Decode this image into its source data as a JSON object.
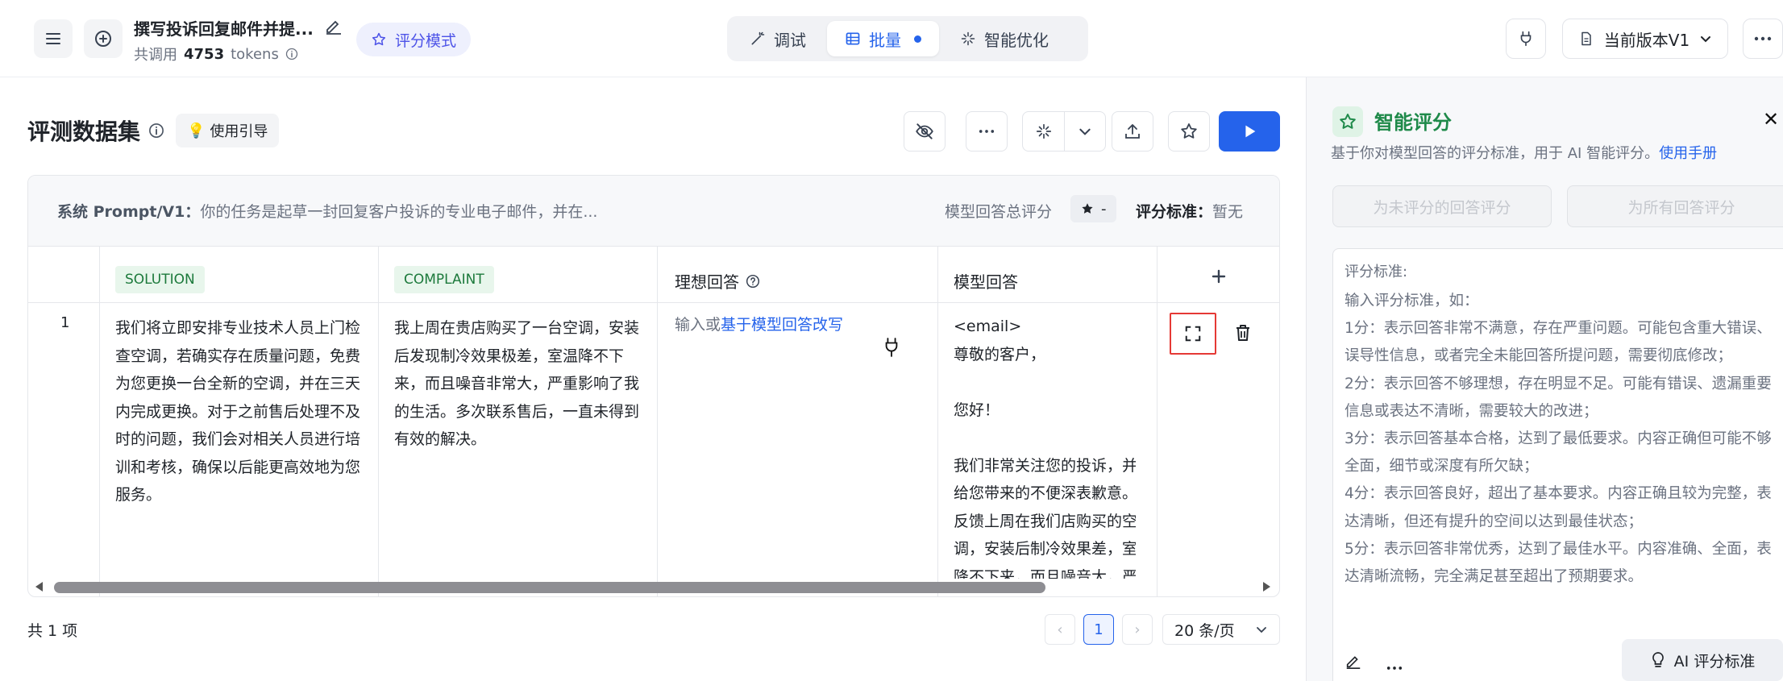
{
  "header": {
    "title": "撰写投诉回复邮件并提...",
    "usage_prefix": "共调用",
    "usage_tokens": "4753",
    "usage_unit": "tokens",
    "score_mode_label": "评分模式",
    "tabs": [
      {
        "label": "调试",
        "icon": "wand-icon",
        "active": false
      },
      {
        "label": "批量",
        "icon": "table-icon",
        "active": true
      },
      {
        "label": "智能优化",
        "icon": "sparkle-icon",
        "active": false
      }
    ],
    "version_label": "当前版本V1"
  },
  "dataset": {
    "title": "评测数据集",
    "guide_label": "使用引导",
    "system_prompt_label": "系统 Prompt/V1：",
    "system_prompt_text": "你的任务是起草一封回复客户投诉的专业电子邮件，并在...",
    "total_score_label": "模型回答总评分",
    "total_score_value": "-",
    "standard_label": "评分标准：",
    "standard_value": "暂无",
    "columns": {
      "solution": "SOLUTION",
      "complaint": "COMPLAINT",
      "ideal": "理想回答",
      "model": "模型回答"
    },
    "rows": [
      {
        "index": "1",
        "solution": "我们将立即安排专业技术人员上门检查空调，若确实存在质量问题，免费为您更换一台全新的空调，并在三天内完成更换。对于之前售后处理不及时的问题，我们会对相关人员进行培训和考核，确保以后能更高效地为您服务。",
        "complaint": "我上周在贵店购买了一台空调，安装后发现制冷效果极差，室温降不下来，而且噪音非常大，严重影响了我的生活。多次联系售后，一直未得到有效的解决。",
        "ideal_prefix": "输入或",
        "ideal_link": "基于模型回答改写",
        "model_lines": [
          "<email>",
          "尊敬的客户，",
          "",
          "您好！",
          "",
          "我们非常关注您的投诉，并对",
          "给您带来的不便深表歉意。您",
          "反馈上周在我们店购买的空",
          "调，安装后制冷效果差，室温",
          "降不下来，而且噪音大，严重"
        ]
      }
    ]
  },
  "pagination": {
    "total_label": "共 1 项",
    "prev": "‹",
    "current_page": "1",
    "next": "›",
    "per_page": "20 条/页"
  },
  "panel": {
    "title": "智能评分",
    "description": "基于你对模型回答的评分标准，用于 AI 智能评分。",
    "manual_link": "使用手册",
    "btn_unscored": "为未评分的回答评分",
    "btn_all": "为所有回答评分",
    "textarea_label": "评分标准:",
    "textarea_content": "输入评分标准，如：\n1分：表示回答非常不满意，存在严重问题。可能包含重大错误、误导性信息，或者完全未能回答所提问题，需要彻底修改；\n2分：表示回答不够理想，存在明显不足。可能有错误、遗漏重要信息或表达不清晰，需要较大的改进；\n3分：表示回答基本合格，达到了最低要求。内容正确但可能不够全面，细节或深度有所欠缺；\n4分：表示回答良好，超出了基本要求。内容正确且较为完整，表达清晰，但还有提升的空间以达到最佳状态；\n5分：表示回答非常优秀，达到了最佳水平。内容准确、全面，表达清晰流畅，完全满足甚至超出了预期要求。",
    "ai_button_label": "AI 评分标准",
    "close_label": "✕"
  },
  "colors": {
    "accent": "#2563eb",
    "green": "#1f8a4a",
    "highlight_border": "#e53935"
  }
}
